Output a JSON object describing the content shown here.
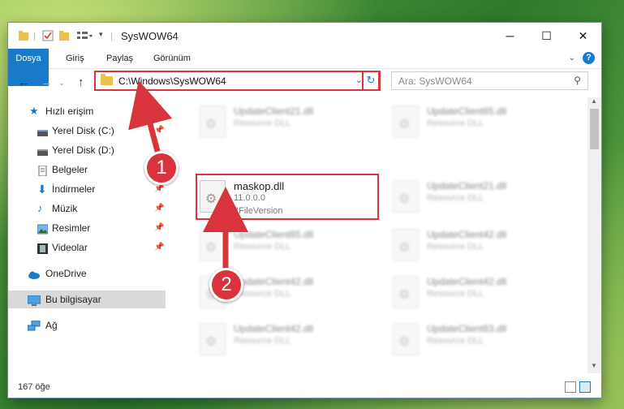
{
  "window": {
    "title": "SysWOW64"
  },
  "ribbon": {
    "tabs": [
      "Dosya",
      "Giriş",
      "Paylaş",
      "Görünüm"
    ],
    "help": "?"
  },
  "nav": {
    "address": "C:\\Windows\\SysWOW64",
    "search_placeholder": "Ara: SysWOW64"
  },
  "sidebar": {
    "items": [
      {
        "label": "Hızlı erişim",
        "icon": "star-icon"
      },
      {
        "label": "Yerel Disk (C:)",
        "icon": "drive-icon"
      },
      {
        "label": "Yerel Disk (D:)",
        "icon": "drive-icon"
      },
      {
        "label": "Belgeler",
        "icon": "documents-icon"
      },
      {
        "label": "İndirmeler",
        "icon": "download-icon"
      },
      {
        "label": "Müzik",
        "icon": "music-icon"
      },
      {
        "label": "Resimler",
        "icon": "pictures-icon"
      },
      {
        "label": "Videolar",
        "icon": "video-icon"
      },
      {
        "label": "OneDrive",
        "icon": "cloud-icon"
      },
      {
        "label": "Bu bilgisayar",
        "icon": "computer-icon"
      },
      {
        "label": "Ağ",
        "icon": "network-icon"
      }
    ]
  },
  "files": [
    {
      "name": "UpdateClient21.dll",
      "desc": "Resource DLL"
    },
    {
      "name": "UpdateClient65.dll",
      "desc": "Resource DLL"
    },
    {
      "name": "maskop.dll",
      "desc": "11.0.0.0",
      "desc2": "2FileVersion"
    },
    {
      "name": "UpdateClient21.dll",
      "desc": "Resource DLL"
    },
    {
      "name": "UpdateClient65.dll",
      "desc": "Resource DLL"
    },
    {
      "name": "UpdateClient42.dll",
      "desc": "Resource DLL"
    },
    {
      "name": "UpdateClient42.dll",
      "desc": "Resource DLL"
    },
    {
      "name": "UpdateClient42.dll",
      "desc": "Resource DLL"
    },
    {
      "name": "UpdateClient42.dll",
      "desc": "Resource DLL"
    },
    {
      "name": "UpdateClient63.dll",
      "desc": "Resource DLL"
    }
  ],
  "status": {
    "count": "167 öğe"
  },
  "callouts": [
    "1",
    "2"
  ],
  "colors": {
    "accent": "#1979ca",
    "highlight": "#d9343d"
  }
}
